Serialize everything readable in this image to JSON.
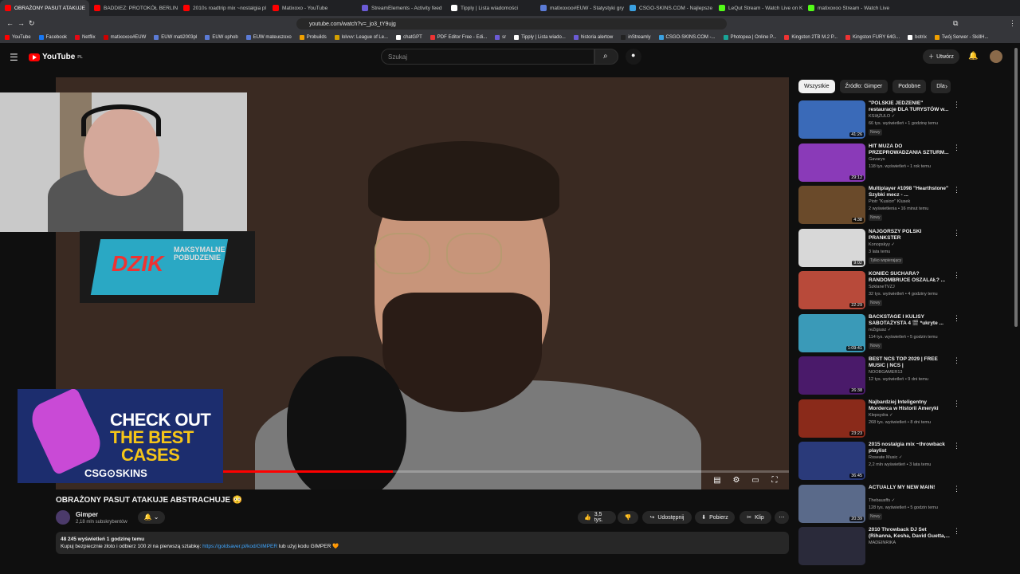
{
  "browser": {
    "tabs": [
      {
        "label": "OBRAŻONY PASUT ATAKUJE",
        "color": "#ff0000",
        "active": true
      },
      {
        "label": "BADDIEZ: PROTOKÓŁ BERLIN - S",
        "color": "#ff0000"
      },
      {
        "label": "2010s roadtrip mix ~nostalgia pl",
        "color": "#ff0000"
      },
      {
        "label": "Matixoxo - YouTube",
        "color": "#ff0000"
      },
      {
        "label": "StreamElements - Activity feed",
        "color": "#6b5bd6"
      },
      {
        "label": "Tipply | Lista wiadomości",
        "color": "#ffffff"
      },
      {
        "label": "matixoxoo#EUW - Statystyki gry",
        "color": "#5b7bd6"
      },
      {
        "label": "CSGO-SKINS.COM - Najlepsze St",
        "color": "#3aa0e0"
      },
      {
        "label": "LeQut Stream - Watch Live on K",
        "color": "#53fc18"
      },
      {
        "label": "matixoxoo Stream - Watch Live",
        "color": "#53fc18"
      }
    ],
    "url": "youtube.com/watch?v=_jo3_tY9ujg",
    "bookmarks": [
      {
        "label": "YouTube",
        "color": "#ff0000"
      },
      {
        "label": "Facebook",
        "color": "#1877f2"
      },
      {
        "label": "Netflix",
        "color": "#e50914"
      },
      {
        "label": "matixoxoo#EUW",
        "color": "#c00"
      },
      {
        "label": "EUW mati2003pl",
        "color": "#5b7bd6"
      },
      {
        "label": "EUW ophob",
        "color": "#5b7bd6"
      },
      {
        "label": "EUW mateuszoxo",
        "color": "#5b7bd6"
      },
      {
        "label": "Probuilds",
        "color": "#f0a000"
      },
      {
        "label": "lolvvv: League of Le...",
        "color": "#d4a000"
      },
      {
        "label": "chatGPT",
        "color": "#ffffff"
      },
      {
        "label": "PDF Editor Free - Edi...",
        "color": "#e33"
      },
      {
        "label": "sr",
        "color": "#6b5bd6"
      },
      {
        "label": "Tipply | Lista wiado...",
        "color": "#ffffff"
      },
      {
        "label": "historia alertow",
        "color": "#6b5bd6"
      },
      {
        "label": "inStreamly",
        "color": "#222"
      },
      {
        "label": "CSGO-SKINS.COM -...",
        "color": "#3aa0e0"
      },
      {
        "label": "Photopea | Online P...",
        "color": "#18a497"
      },
      {
        "label": "Kingston 2TB M.2 P...",
        "color": "#e33"
      },
      {
        "label": "Kingston FURY 64G...",
        "color": "#e33"
      },
      {
        "label": "botrix",
        "color": "#ffffff"
      },
      {
        "label": "Twój Serwer - SkillH...",
        "color": "#f0a000"
      }
    ]
  },
  "youtube": {
    "logo_text": "YouTube",
    "logo_region": "PL",
    "search_placeholder": "Szukaj",
    "create_label": "Utwórz"
  },
  "player": {
    "progress_fraction": 0.46,
    "promo_line1": "CHECK OUT",
    "promo_line2": "THE BEST",
    "promo_line3": "CASES",
    "promo_logo": "CSG⊙SKINS",
    "can_text": "DZIK",
    "can_sub": "MAKSYMALNE POBUDZENIE"
  },
  "video": {
    "title": "OBRAŻONY PASUT ATAKUJE ABSTRACHUJE 😳",
    "channel": "Gimper",
    "subscribers": "2,18 mln subskrybentów",
    "likes": "3,5 tys.",
    "share_label": "Udostępnij",
    "download_label": "Pobierz",
    "clip_label": "Klip",
    "views_line": "48 245 wyświetleń  1 godzinę temu",
    "desc_prefix": "Kupuj bezpiecznie złoto i odbierz 100 zł na pierwszą sztabkę: ",
    "desc_link": "https://goldsaver.pl/kod/GIMPER",
    "desc_suffix": " lub użyj kodu GIMPER 🧡"
  },
  "chips": [
    "Wszystkie",
    "Źródło: Gimper",
    "Podobne",
    "Dla"
  ],
  "recommendations": [
    {
      "title": "\"POLSKIE JEDZENIE\" restauracje DLA TURYSTÓW w...",
      "channel": "KSIĄŻULO ✓",
      "meta": "66 tys. wyświetleń • 1 godzinę temu",
      "badge": "Nowy",
      "duration": "41:26",
      "color": "#3a6ab8"
    },
    {
      "title": "HIT MUZA DO PRZEPROWADZANIA SZTURM...",
      "channel": "Gavarys",
      "meta": "118 tys. wyświetleń • 1 rok temu",
      "badge": "",
      "duration": "29:12",
      "color": "#8a3ab8"
    },
    {
      "title": "Multiplayer #1098 \"Hearthstone\" Szybki mecz - ...",
      "channel": "Piotr \"Kusiorr\" Klusek",
      "meta": "2 wyświetlenia • 16 minut temu",
      "badge": "Nowy",
      "duration": "4:38",
      "color": "#6a4a2a"
    },
    {
      "title": "NAJGORSZY POLSKI PRANKSTER",
      "channel": "Konopskyy ✓",
      "meta": "3 lata temu",
      "badge": "Tylko wspierający",
      "duration": "9:02",
      "color": "#d8d8d8"
    },
    {
      "title": "KONIEC SUCHARA? RANDOMBRUCE OSZALAŁ? ...",
      "channel": "SzklaneTVZJ",
      "meta": "32 tys. wyświetleń • 4 godziny temu",
      "badge": "Nowy",
      "duration": "22:29",
      "color": "#b84a3a"
    },
    {
      "title": "BACKSTAGE I KULISY SABOTAŻYSTA 4 🎬 *ukryte ...",
      "channel": "reZigiusz ✓",
      "meta": "114 tys. wyświetleń • 5 godzin temu",
      "badge": "Nowy",
      "duration": "1:09:41",
      "color": "#3a9ab8"
    },
    {
      "title": "BEST NCS TOP 2029 | FREE MUSIC | NCS |",
      "channel": "NOOBGAMER13",
      "meta": "12 tys. wyświetleń • 9 dni temu",
      "badge": "",
      "duration": "26:38",
      "color": "#4a1a6a"
    },
    {
      "title": "Najbardziej Inteligentny Morderca w Historii Ameryki",
      "channel": "Klepsydra ✓",
      "meta": "268 tys. wyświetleń • 8 dni temu",
      "badge": "",
      "duration": "23:23",
      "color": "#8a2a1a"
    },
    {
      "title": "2015 nostalgia mix ~throwback playlist",
      "channel": "Roseate Music ✓",
      "meta": "2,2 mln wyświetleń • 3 lata temu",
      "badge": "",
      "duration": "36:45",
      "color": "#2a3a7a"
    },
    {
      "title": "ACTUALLY MY NEW MAIN!",
      "channel": "Thebausffs ✓",
      "meta": "128 tys. wyświetleń • 5 godzin temu",
      "badge": "Nowy",
      "duration": "20:39",
      "color": "#5a6a8a"
    },
    {
      "title": "2010 Throwback DJ Set (Rihanna, Kesha, David Guetta,...",
      "channel": "MADEINRIKA",
      "meta": "",
      "badge": "",
      "duration": "",
      "color": "#2a2a3a"
    }
  ]
}
